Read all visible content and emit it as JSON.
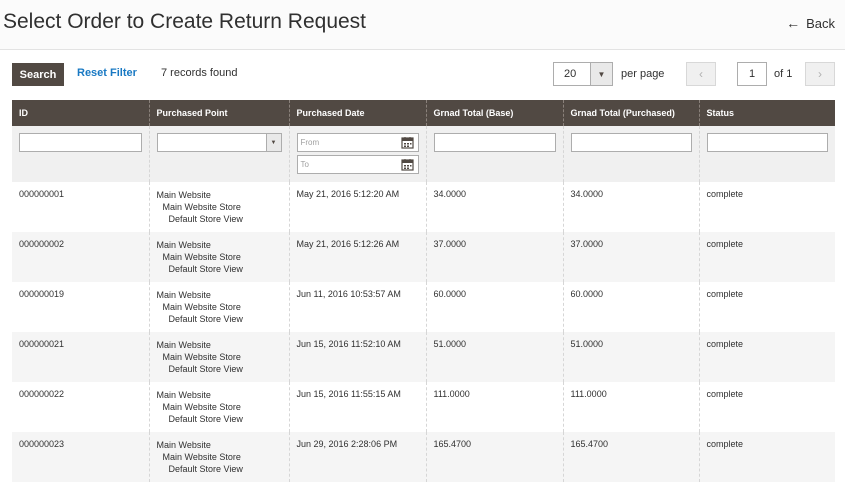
{
  "header": {
    "title": "Select Order to Create Return Request",
    "back_label": "Back"
  },
  "toolbar": {
    "search_label": "Search",
    "reset_label": "Reset Filter",
    "records_found": "7 records found",
    "per_page_value": "20",
    "per_page_label": "per page",
    "page_current": "1",
    "page_of": "of 1"
  },
  "icons": {
    "back": "arrow-left-icon",
    "prev": "chevron-left-icon",
    "next": "chevron-right-icon",
    "dropdown": "caret-down-icon",
    "calendar": "calendar-icon"
  },
  "colors": {
    "header_bg": "#514943",
    "link": "#1979c3",
    "search_btn": "#514943"
  },
  "grid": {
    "columns": [
      "ID",
      "Purchased Point",
      "Purchased Date",
      "Grnad Total (Base)",
      "Grnad Total (Purchased)",
      "Status"
    ],
    "filters": {
      "date_from_placeholder": "From",
      "date_to_placeholder": "To"
    },
    "rows": [
      {
        "id": "000000001",
        "point": [
          "Main Website",
          "Main Website Store",
          "Default Store View"
        ],
        "date": "May 21, 2016 5:12:20 AM",
        "base": "34.0000",
        "purchased": "34.0000",
        "status": "complete"
      },
      {
        "id": "000000002",
        "point": [
          "Main Website",
          "Main Website Store",
          "Default Store View"
        ],
        "date": "May 21, 2016 5:12:26 AM",
        "base": "37.0000",
        "purchased": "37.0000",
        "status": "complete"
      },
      {
        "id": "000000019",
        "point": [
          "Main Website",
          "Main Website Store",
          "Default Store View"
        ],
        "date": "Jun 11, 2016 10:53:57 AM",
        "base": "60.0000",
        "purchased": "60.0000",
        "status": "complete"
      },
      {
        "id": "000000021",
        "point": [
          "Main Website",
          "Main Website Store",
          "Default Store View"
        ],
        "date": "Jun 15, 2016 11:52:10 AM",
        "base": "51.0000",
        "purchased": "51.0000",
        "status": "complete"
      },
      {
        "id": "000000022",
        "point": [
          "Main Website",
          "Main Website Store",
          "Default Store View"
        ],
        "date": "Jun 15, 2016 11:55:15 AM",
        "base": "111.0000",
        "purchased": "111.0000",
        "status": "complete"
      },
      {
        "id": "000000023",
        "point": [
          "Main Website",
          "Main Website Store",
          "Default Store View"
        ],
        "date": "Jun 29, 2016 2:28:06 PM",
        "base": "165.4700",
        "purchased": "165.4700",
        "status": "complete"
      }
    ]
  }
}
